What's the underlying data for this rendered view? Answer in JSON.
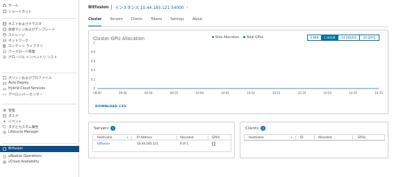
{
  "sidebar": {
    "items": [
      {
        "label": "ホーム",
        "icon": "home-icon"
      },
      {
        "label": "ショートカット",
        "icon": "shortcut-icon"
      },
      {
        "label": "ホストおよびクラスタ",
        "icon": "host-cluster-icon"
      },
      {
        "label": "仮想マシンおよびテンプレート",
        "icon": "vm-template-icon"
      },
      {
        "label": "ストレージ",
        "icon": "storage-icon"
      },
      {
        "label": "ネットワーク",
        "icon": "network-icon"
      },
      {
        "label": "コンテンツ ライブラリ",
        "icon": "content-library-icon"
      },
      {
        "label": "ワークロード管理",
        "icon": "workload-icon"
      },
      {
        "label": "グローバル インベントリ リスト",
        "icon": "inventory-list-icon"
      },
      {
        "label": "ポリシーおよびプロファイル",
        "icon": "policy-icon"
      },
      {
        "label": "Auto Deploy",
        "icon": "auto-deploy-icon"
      },
      {
        "label": "Hybrid Cloud Services",
        "icon": "hybrid-cloud-icon"
      },
      {
        "label": "デベロッパー センター",
        "icon": "developer-icon"
      },
      {
        "label": "管理",
        "icon": "admin-icon"
      },
      {
        "label": "タスク",
        "icon": "tasks-icon"
      },
      {
        "label": "イベント",
        "icon": "events-icon"
      },
      {
        "label": "タグとカスタム属性",
        "icon": "tags-icon"
      },
      {
        "label": "Lifecycle Manager",
        "icon": "lifecycle-icon"
      },
      {
        "label": "Bitfusion",
        "icon": "bitfusion-icon"
      },
      {
        "label": "vRealize Operations",
        "icon": "vrealize-icon"
      },
      {
        "label": "vCloud Availability",
        "icon": "vcloud-icon"
      }
    ]
  },
  "header": {
    "app_name": "Bitfusion",
    "instance": "インスタンス 10.44.185.121:54000",
    "chevron": "›"
  },
  "tabs": [
    "Cluster",
    "Servers",
    "Clients",
    "Tokens",
    "Settings",
    "About"
  ],
  "gpu_card": {
    "title": "Cluster GPU Allocation",
    "legend": [
      "Total Allocation",
      "Total GPUs"
    ],
    "ranges": [
      "5 MIN",
      "1 HOUR",
      "24 HOURS",
      "20 DAYS"
    ],
    "active_range": "1 HOUR",
    "download_label": "DOWNLOAD CSV"
  },
  "chart_data": {
    "type": "line",
    "title": "Cluster GPU Allocation",
    "x": [
      "09:40",
      "09:45",
      "09:50",
      "09:55",
      "10:00",
      "10:05",
      "10:10",
      "10:15",
      "10:20",
      "10:25",
      "10:30",
      "10:35"
    ],
    "yticks": [
      "1",
      "0.8",
      "0.6",
      "0.4",
      "0.2",
      "0"
    ],
    "ylim": [
      0,
      1
    ],
    "series": [
      {
        "name": "Total Allocation",
        "values": []
      },
      {
        "name": "Total GPUs",
        "values": []
      }
    ],
    "legend": "top-right",
    "grid": false
  },
  "servers": {
    "title": "Servers",
    "count": "1",
    "columns": [
      "Hostname",
      "IP Address",
      "Allocated",
      "GPUs"
    ],
    "rows": [
      {
        "hostname": "bitfusion",
        "ip": "10.44.185.121",
        "allocated": "0 of 1"
      }
    ]
  },
  "clients": {
    "title": "Clients",
    "count": "0",
    "columns": [
      "Hostname",
      "ID",
      "Allocated",
      "GPUs"
    ]
  },
  "colors": {
    "accent": "#0072a3",
    "active_nav": "#0f4c81",
    "allocation_series": "#2e8b57",
    "gpus_series": "#0072a3"
  }
}
